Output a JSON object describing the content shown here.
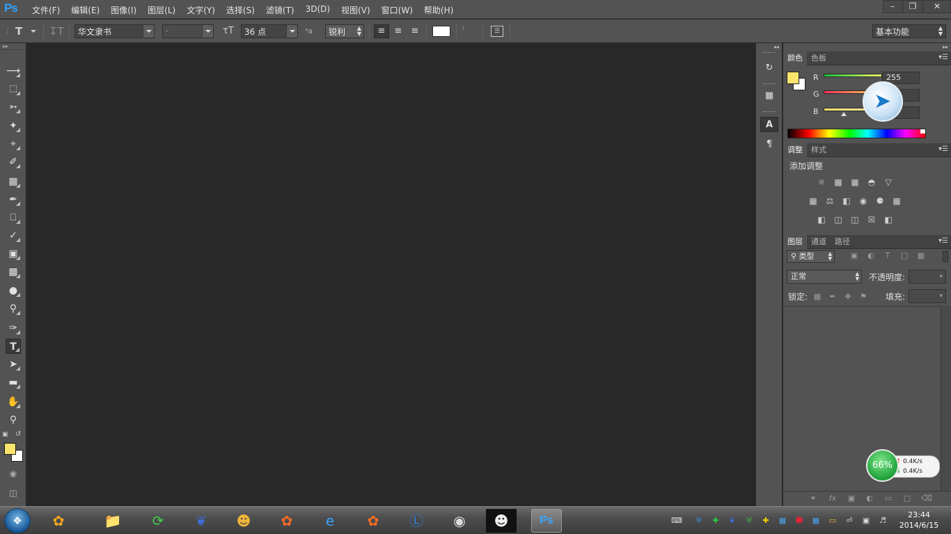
{
  "app": {
    "logo": "Ps"
  },
  "menu": [
    "文件(F)",
    "编辑(E)",
    "图像(I)",
    "图层(L)",
    "文字(Y)",
    "选择(S)",
    "滤镜(T)",
    "3D(D)",
    "视图(V)",
    "窗口(W)",
    "帮助(H)"
  ],
  "options": {
    "font_family": "华文隶书",
    "font_style": "-",
    "font_size": "36 点",
    "antialias": "锐利",
    "text_color": "#ffffff",
    "workspace": "基本功能"
  },
  "colors": {
    "foreground": "#fbe56c",
    "background": "#ffffff"
  },
  "color_panel": {
    "tabs": [
      "颜色",
      "色板"
    ],
    "r_label": "R",
    "g_label": "G",
    "b_label": "B",
    "r_value": "255"
  },
  "adjust_panel": {
    "tabs": [
      "调整",
      "样式"
    ],
    "title": "添加调整"
  },
  "layers_panel": {
    "tabs": [
      "图层",
      "通道",
      "路径"
    ],
    "filter": "类型",
    "blend_mode": "正常",
    "opacity_label": "不透明度:",
    "lock_label": "锁定:",
    "fill_label": "填充:"
  },
  "net_widget": {
    "percent": "66%",
    "up": "0.4K/s",
    "down": "0.4K/s"
  },
  "clock": {
    "time": "23:44",
    "date": "2014/6/15"
  }
}
